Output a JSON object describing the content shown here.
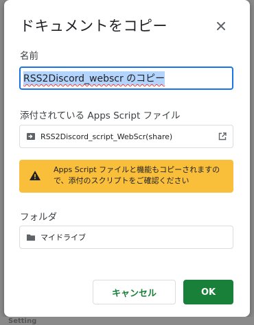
{
  "dialog": {
    "title": "ドキュメントをコピー",
    "name_label": "名前",
    "name_value": "RSS2Discord_webscr のコピー",
    "attached_label": "添付されている Apps Script ファイル",
    "attached_file": "RSS2Discord_script_WebScr(share)",
    "warning_text": "Apps Script ファイルと機能もコピーされますので、添付のスクリプトをご確認ください",
    "folder_label": "フォルダ",
    "folder_value": "マイドライブ",
    "cancel_label": "キャンセル",
    "ok_label": "OK"
  },
  "background": {
    "partial_text": "Setting"
  },
  "colors": {
    "accent": "#188038",
    "focus": "#1a73e8",
    "warning": "#f9bf3b"
  },
  "icons": {
    "close": "close-icon",
    "script": "apps-script-icon",
    "open": "open-in-new-icon",
    "warning": "warning-icon",
    "folder": "folder-icon"
  }
}
